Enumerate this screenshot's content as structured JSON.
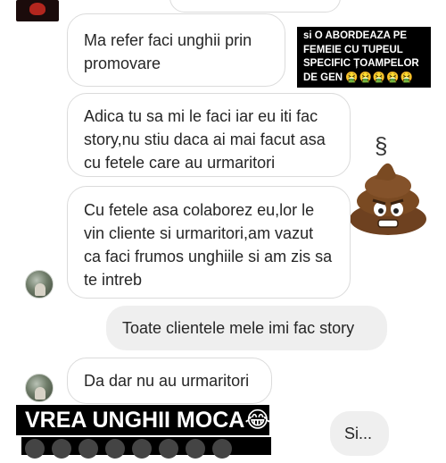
{
  "messages": {
    "m1": "Ma refer faci unghii prin promovare",
    "m2": "Adica tu sa mi le faci iar eu iti fac story,nu stiu daca ai mai facut asa cu fetele care au urmaritori",
    "m3": "Cu fetele asa colaborez eu,lor le vin cliente si urmaritori,am vazut ca faci frumos unghiile si am zis sa te intreb",
    "m4": "Toate clientele mele imi fac story",
    "m5": "Da dar nu au urmaritori",
    "m6": "Si..."
  },
  "overlay": {
    "caption_text": "si O ABORDEAZA PE FEMEIE CU TUPEUL SPECIFIC ȚOAMPELOR DE GEN",
    "caption_emojis": "🤮🤮🤮🤮🤮",
    "banner_text": "VREA UNGHII MOCA😂",
    "steam_glyph": "§"
  },
  "icons": {
    "poop": "poop-emoji-icon",
    "avatar": "contact-avatar",
    "logo": "account-logo-icon"
  },
  "colors": {
    "sent_bubble": "#efefef",
    "received_border": "#dbdbdb",
    "overlay_bg": "#000000",
    "poop_brown": "#7a4a22"
  }
}
